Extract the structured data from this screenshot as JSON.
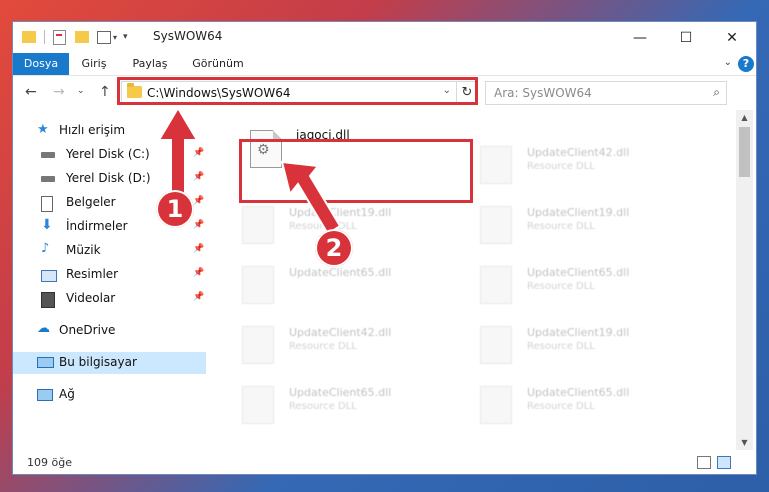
{
  "window": {
    "title": "SysWOW64",
    "minimize_glyph": "—",
    "maximize_glyph": "☐",
    "close_glyph": "✕"
  },
  "ribbon": {
    "tabs": [
      "Dosya",
      "Giriş",
      "Paylaş",
      "Görünüm"
    ],
    "help": "?"
  },
  "nav": {
    "address": "C:\\Windows\\SysWOW64",
    "search_placeholder": "Ara: SysWOW64"
  },
  "sidebar": {
    "items": [
      {
        "label": "Hızlı erişim",
        "icon": "star-icon"
      },
      {
        "label": "Yerel Disk (C:)",
        "icon": "drive-icon"
      },
      {
        "label": "Yerel Disk (D:)",
        "icon": "drive-icon"
      },
      {
        "label": "Belgeler",
        "icon": "documents-icon"
      },
      {
        "label": "İndirmeler",
        "icon": "download-icon"
      },
      {
        "label": "Müzik",
        "icon": "music-icon"
      },
      {
        "label": "Resimler",
        "icon": "pictures-icon"
      },
      {
        "label": "Videolar",
        "icon": "videos-icon"
      },
      {
        "label": "OneDrive",
        "icon": "cloud-icon"
      },
      {
        "label": "Bu bilgisayar",
        "icon": "computer-icon"
      },
      {
        "label": "Ağ",
        "icon": "network-icon"
      }
    ]
  },
  "files": {
    "highlighted": "jaqoci.dll",
    "ghost_left": [
      {
        "name": "UpdateClient19.dll",
        "type": "Resource DLL"
      },
      {
        "name": "UpdateClient65.dll",
        "type": ""
      },
      {
        "name": "UpdateClient42.dll",
        "type": "Resource DLL"
      },
      {
        "name": "UpdateClient65.dll",
        "type": "Resource DLL"
      }
    ],
    "ghost_right": [
      {
        "name": "UpdateClient42.dll",
        "type": "Resource DLL"
      },
      {
        "name": "UpdateClient19.dll",
        "type": "Resource DLL"
      },
      {
        "name": "UpdateClient65.dll",
        "type": "Resource DLL"
      },
      {
        "name": "UpdateClient19.dll",
        "type": "Resource DLL"
      },
      {
        "name": "UpdateClient65.dll",
        "type": "Resource DLL"
      }
    ]
  },
  "status": {
    "count": "109 öğe"
  },
  "annotations": {
    "step1": "1",
    "step2": "2"
  },
  "colors": {
    "accent": "#1979ca",
    "highlight_red": "#d8333b",
    "selection": "#cce8ff"
  }
}
